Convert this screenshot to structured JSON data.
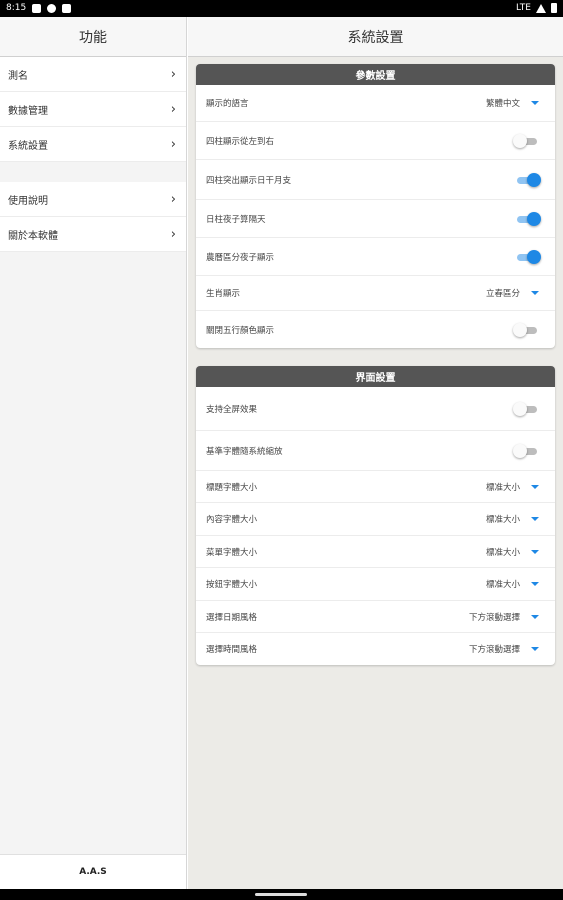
{
  "status_bar": {
    "time": "8:15",
    "network": "LTE"
  },
  "left_pane": {
    "title": "功能",
    "menu_group_1": [
      {
        "label": "測名"
      },
      {
        "label": "數據管理"
      },
      {
        "label": "系統設置"
      }
    ],
    "menu_group_2": [
      {
        "label": "使用說明"
      },
      {
        "label": "關於本軟體"
      }
    ],
    "footer": "A.A.S",
    "chevron_glyph": "›"
  },
  "right_pane": {
    "title": "系統設置",
    "param_section": {
      "title": "參數設置",
      "rows": [
        {
          "label": "顯示的語言",
          "value": "繁體中文",
          "type": "dropdown"
        },
        {
          "label": "四柱顯示從左到右",
          "type": "toggle",
          "on": false
        },
        {
          "label": "四柱突出顯示日干月支",
          "type": "toggle",
          "on": true
        },
        {
          "label": "日柱夜子算隔天",
          "type": "toggle",
          "on": true
        },
        {
          "label": "農曆區分夜子顯示",
          "type": "toggle",
          "on": true
        },
        {
          "label": "生肖顯示",
          "value": "立春區分",
          "type": "dropdown"
        },
        {
          "label": "關閉五行顏色顯示",
          "type": "toggle",
          "on": false
        }
      ]
    },
    "ui_section": {
      "title": "界面設置",
      "rows": [
        {
          "label": "支持全屏效果",
          "type": "toggle",
          "on": false
        },
        {
          "label": "基準字體隨系統縮放",
          "type": "toggle",
          "on": false
        },
        {
          "label": "標題字體大小",
          "value": "標准大小",
          "type": "dropdown"
        },
        {
          "label": "內容字體大小",
          "value": "標准大小",
          "type": "dropdown"
        },
        {
          "label": "菜單字體大小",
          "value": "標准大小",
          "type": "dropdown"
        },
        {
          "label": "按鈕字體大小",
          "value": "標准大小",
          "type": "dropdown"
        },
        {
          "label": "選擇日期風格",
          "value": "下方滾動選擇",
          "type": "dropdown"
        },
        {
          "label": "選擇時間風格",
          "value": "下方滾動選擇",
          "type": "dropdown"
        }
      ]
    }
  },
  "colors": {
    "accent": "#1e88e5",
    "card_header": "#555555",
    "pane_bg": "#ecebe7"
  }
}
